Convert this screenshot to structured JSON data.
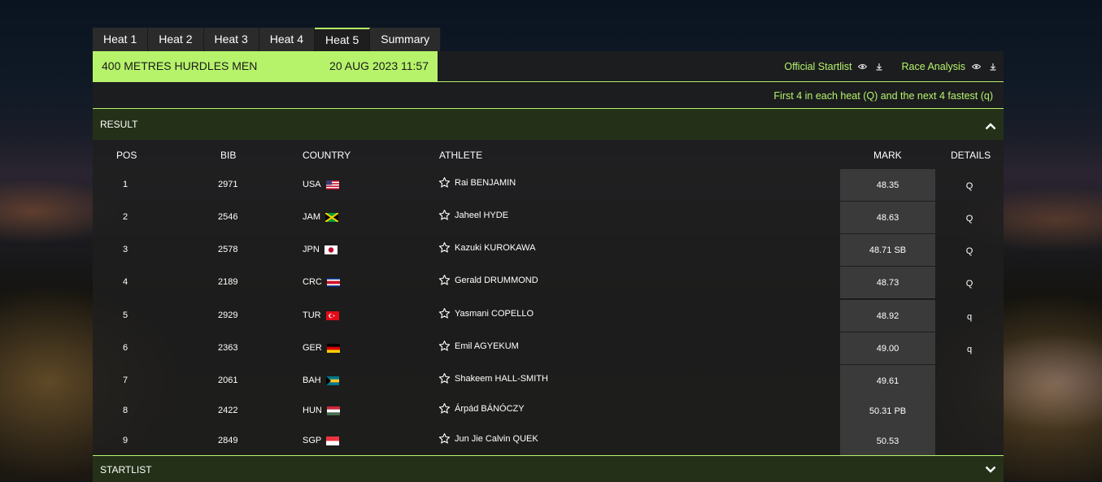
{
  "tabs": [
    {
      "label": "Heat 1"
    },
    {
      "label": "Heat 2"
    },
    {
      "label": "Heat 3"
    },
    {
      "label": "Heat 4"
    },
    {
      "label": "Heat 5"
    },
    {
      "label": "Summary"
    }
  ],
  "event": {
    "name": "400 METRES HURDLES MEN",
    "date": "20 AUG 2023 11:57"
  },
  "links": {
    "startlist": "Official Startlist",
    "analysis": "Race Analysis"
  },
  "qualification": "First 4 in each heat (Q) and the next 4 fastest (q)",
  "sections": {
    "result": "RESULT",
    "startlist": "STARTLIST"
  },
  "columns": {
    "pos": "POS",
    "bib": "BIB",
    "country": "COUNTRY",
    "athlete": "ATHLETE",
    "mark": "MARK",
    "details": "DETAILS"
  },
  "colors": {
    "accent": "#b6f36b",
    "panel": "#1e1e1e",
    "section": "#243118"
  },
  "rows": [
    {
      "pos": "1",
      "bib": "2971",
      "country": "USA",
      "flag": "usa",
      "athlete": "Rai BENJAMIN",
      "mark": "48.35",
      "detail": "Q"
    },
    {
      "pos": "2",
      "bib": "2546",
      "country": "JAM",
      "flag": "jam",
      "athlete": "Jaheel HYDE",
      "mark": "48.63",
      "detail": "Q"
    },
    {
      "pos": "3",
      "bib": "2578",
      "country": "JPN",
      "flag": "jpn",
      "athlete": "Kazuki KUROKAWA",
      "mark": "48.71 SB",
      "detail": "Q"
    },
    {
      "pos": "4",
      "bib": "2189",
      "country": "CRC",
      "flag": "crc",
      "athlete": "Gerald DRUMMOND",
      "mark": "48.73",
      "detail": "Q"
    },
    {
      "pos": "5",
      "bib": "2929",
      "country": "TUR",
      "flag": "tur",
      "athlete": "Yasmani COPELLO",
      "mark": "48.92",
      "detail": "q"
    },
    {
      "pos": "6",
      "bib": "2363",
      "country": "GER",
      "flag": "ger",
      "athlete": "Emil AGYEKUM",
      "mark": "49.00",
      "detail": "q"
    },
    {
      "pos": "7",
      "bib": "2061",
      "country": "BAH",
      "flag": "bah",
      "athlete": "Shakeem HALL-SMITH",
      "mark": "49.61",
      "detail": ""
    },
    {
      "pos": "8",
      "bib": "2422",
      "country": "HUN",
      "flag": "hun",
      "athlete": "Árpád BÁNÓCZY",
      "mark": "50.31 PB",
      "detail": ""
    },
    {
      "pos": "9",
      "bib": "2849",
      "country": "SGP",
      "flag": "sgp",
      "athlete": "Jun Jie Calvin QUEK",
      "mark": "50.53",
      "detail": ""
    }
  ]
}
